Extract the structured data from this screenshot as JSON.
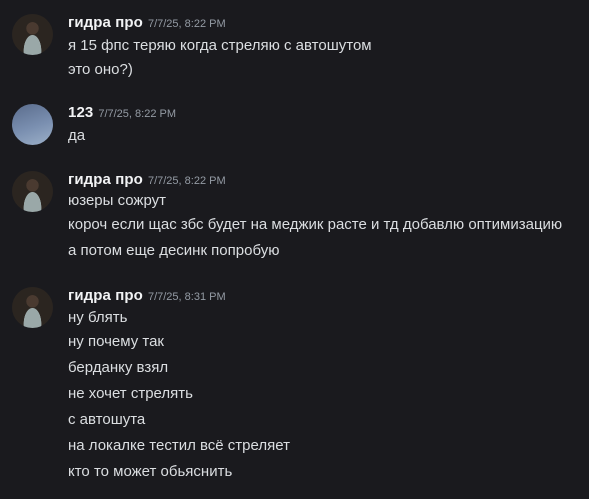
{
  "messages": [
    {
      "author": "гидра про",
      "time": "7/7/25, 8:22 PM",
      "avatar": "portrait-avatar",
      "lines": [
        "я 15 фпс теряю когда стреляю с автошутом",
        "это оно?)"
      ]
    },
    {
      "author": "123",
      "time": "7/7/25, 8:22 PM",
      "avatar": "blue-gradient-avatar",
      "lines": [
        "да"
      ]
    },
    {
      "author": "гидра про",
      "time": "7/7/25, 8:22 PM",
      "avatar": "portrait-avatar",
      "lines": [
        "юзеры сожрут",
        "короч если щас збс будет на меджик расте и тд добавлю оптимизацию",
        "а потом еще десинк попробую"
      ]
    },
    {
      "author": "гидра про",
      "time": "7/7/25, 8:31 PM",
      "avatar": "portrait-avatar",
      "lines": [
        "ну блять",
        "ну почему так",
        "берданку взял",
        "не хочет стрелять",
        "с автошута",
        "на локалке тестил всё стреляет",
        "кто то может обьяснить"
      ]
    }
  ]
}
